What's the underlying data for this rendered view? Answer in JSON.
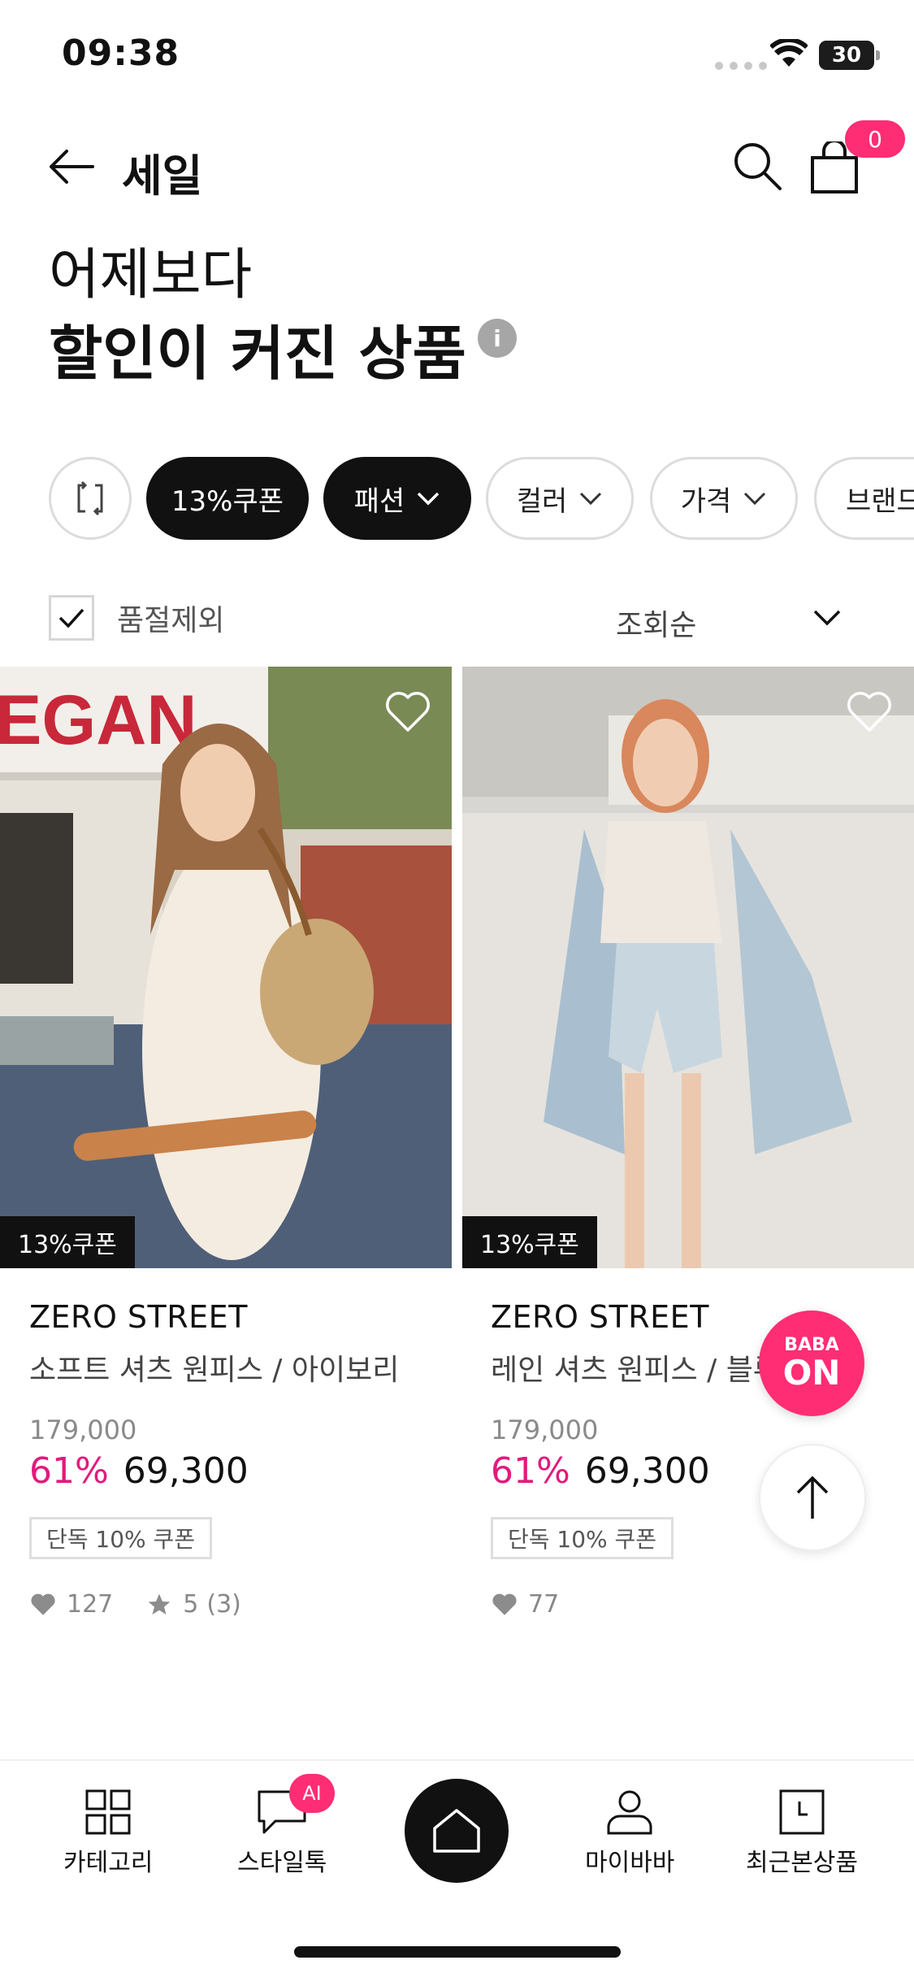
{
  "status_bar": {
    "time": "09:38",
    "battery": "30"
  },
  "header": {
    "title": "세일",
    "cart_count": "0"
  },
  "hero": {
    "line1": "어제보다",
    "line2": "할인이 커진 상품",
    "info_icon": "i"
  },
  "filters": [
    {
      "label": "13%쿠폰",
      "active": true
    },
    {
      "label": "패션",
      "active": true,
      "dropdown": true
    },
    {
      "label": "컬러",
      "active": false,
      "dropdown": true
    },
    {
      "label": "가격",
      "active": false,
      "dropdown": true
    },
    {
      "label": "브랜드",
      "active": false
    }
  ],
  "options": {
    "exclude_soldout": "품절제외",
    "exclude_soldout_checked": true,
    "sort": "조회순"
  },
  "products": [
    {
      "coupon_tag": "13%쿠폰",
      "brand": "ZERO STREET",
      "name": "소프트 셔츠 원피스 / 아이보리",
      "original_price": "179,000",
      "discount": "61%",
      "price": "69,300",
      "coupon": "단독 10% 쿠폰",
      "likes": "127",
      "rating": "5",
      "reviews": "(3)"
    },
    {
      "coupon_tag": "13%쿠폰",
      "brand": "ZERO STREET",
      "name": "레인 셔츠 원피스 / 블루",
      "original_price": "179,000",
      "discount": "61%",
      "price": "69,300",
      "coupon": "단독 10% 쿠폰",
      "likes": "77"
    }
  ],
  "photo_sign_text": "EGAN",
  "floating": {
    "baba_small": "BABA",
    "baba_big": "ON"
  },
  "bottom_nav": {
    "category": "카테고리",
    "styletalk": "스타일톡",
    "ai_badge": "AI",
    "mypage": "마이바바",
    "recent": "최근본상품"
  },
  "colors": {
    "accent_pink": "#ff2d73",
    "discount_magenta": "#e21a7c",
    "dark": "#111111"
  },
  "icons": [
    "back-arrow-icon",
    "search-icon",
    "shopping-bag-icon",
    "info-icon",
    "refresh-icon",
    "chevron-down-icon",
    "check-icon",
    "heart-outline-icon",
    "heart-icon",
    "star-icon",
    "arrow-up-icon",
    "grid-icon",
    "chat-icon",
    "home-icon",
    "person-icon",
    "clock-icon"
  ]
}
